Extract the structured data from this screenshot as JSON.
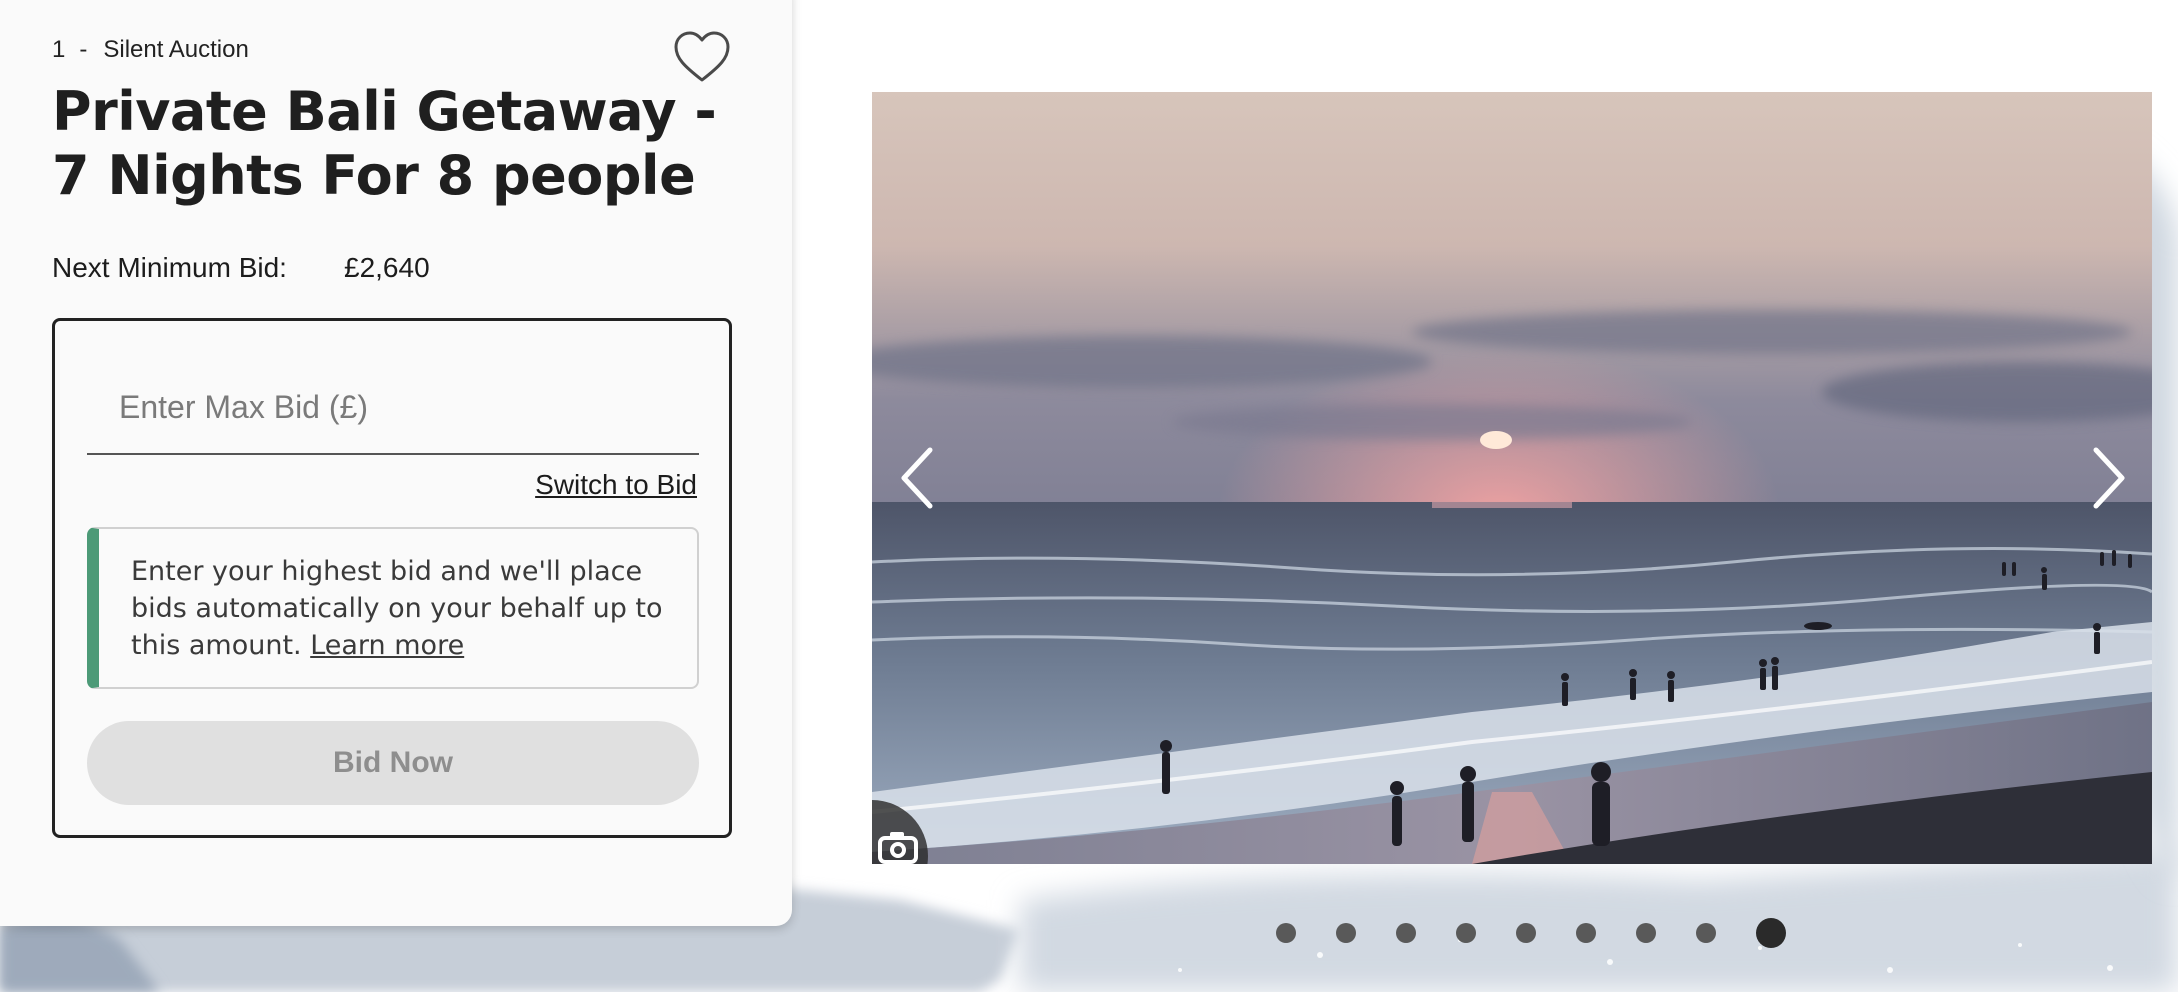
{
  "lot": {
    "number": "1",
    "separator": "-",
    "type": "Silent Auction",
    "favorite_icon": "heart-outline-icon"
  },
  "title": "Private Bali Getaway - 7 Nights For 8 people",
  "min_bid": {
    "label": "Next Minimum Bid:",
    "value": "£2,640"
  },
  "bid_form": {
    "placeholder": "Enter Max Bid (£)",
    "value": "",
    "switch_label": "Switch to Bid",
    "info_text": "Enter your highest bid and we'll place bids automatically on your behalf up to this amount.",
    "learn_more": "Learn more",
    "accent_color": "#4c9a77",
    "bid_button_label": "Bid Now",
    "bid_button_disabled": true
  },
  "gallery": {
    "image_subject": "sunset over beach with people walking along the shoreline",
    "prev_icon": "chevron-left-icon",
    "next_icon": "chevron-right-icon",
    "camera_icon": "camera-icon",
    "total_slides": 9,
    "active_slide": 9
  }
}
